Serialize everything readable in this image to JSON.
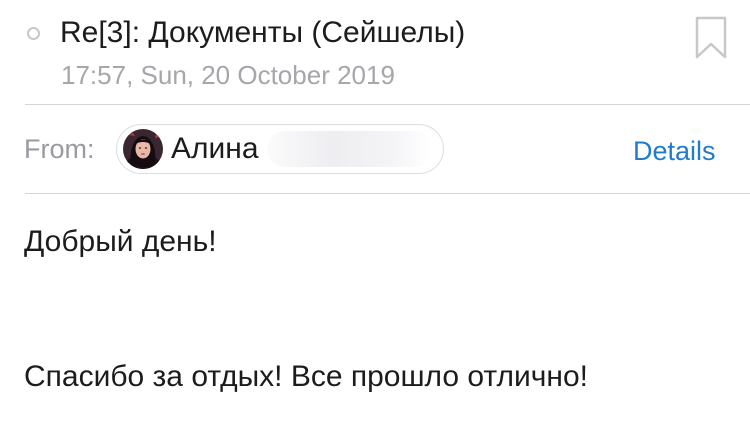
{
  "message": {
    "subject": "Re[3]: Документы (Сейшелы)",
    "date": "17:57, Sun, 20 October 2019",
    "unread_indicator_icon": "circle-outline-icon",
    "bookmark_icon": "bookmark-icon"
  },
  "sender": {
    "from_label": "From:",
    "name": "Алина",
    "avatar_icon": "avatar-photo",
    "details_label": "Details"
  },
  "body": {
    "lines": [
      "Добрый день!",
      "Спасибо за отдых! Все прошло отлично!"
    ]
  },
  "colors": {
    "accent": "#1f7ccc",
    "secondary_text": "#a6a6ab",
    "primary_text": "#1c1c1e",
    "divider": "#d4d4d8"
  }
}
